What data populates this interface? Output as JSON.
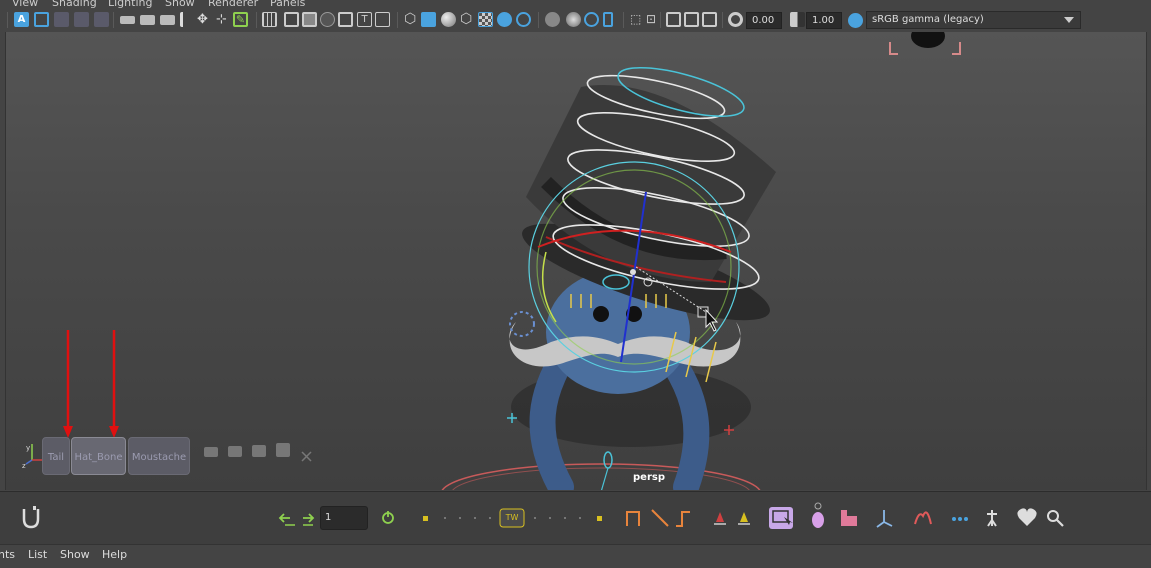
{
  "menu": {
    "view": "View",
    "shading": "Shading",
    "lighting": "Lighting",
    "show": "Show",
    "renderer": "Renderer",
    "panels": "Panels"
  },
  "toolbar": {
    "exposure_value": "0.00",
    "gamma_value": "1.00",
    "color_space": "sRGB gamma (legacy)"
  },
  "viewport": {
    "camera_label": "persp"
  },
  "shelf": {
    "buttons": [
      "Tail",
      "Hat_Bone",
      "Moustache"
    ]
  },
  "animbar": {
    "frame_value": "1",
    "tw_label": "TW"
  },
  "bottom_menu": {
    "items": [
      "nts",
      "List",
      "Show",
      "Help"
    ]
  },
  "colors": {
    "accent_blue": "#4aa3df",
    "icon_green": "#8fd14f",
    "key_orange": "#e8843c",
    "annotation_red": "#e01010"
  }
}
